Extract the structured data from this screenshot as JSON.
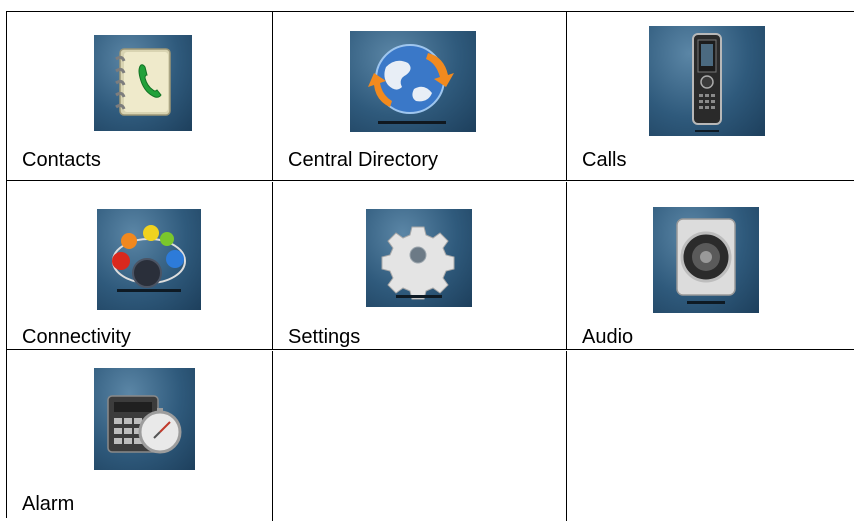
{
  "menu": {
    "items": [
      {
        "label": "Contacts",
        "icon": "contacts-book-icon"
      },
      {
        "label": "Central Directory",
        "icon": "globe-directory-icon"
      },
      {
        "label": "Calls",
        "icon": "phone-handset-icon"
      },
      {
        "label": "Connectivity",
        "icon": "network-nodes-icon"
      },
      {
        "label": "Settings",
        "icon": "gear-icon"
      },
      {
        "label": "Audio",
        "icon": "speaker-icon"
      },
      {
        "label": "Alarm",
        "icon": "alarm-calculator-clock-icon"
      }
    ]
  },
  "colors": {
    "tile_background": "#2f5a7c",
    "grid_lines": "#000000",
    "text": "#000000"
  }
}
